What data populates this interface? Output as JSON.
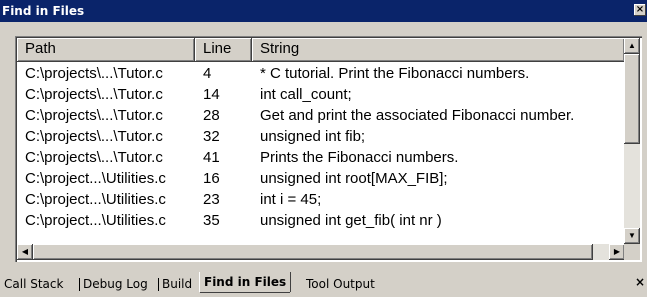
{
  "window": {
    "title": "Find in Files",
    "close_glyph": "×",
    "close_icon": "close-icon"
  },
  "columns": [
    "Path",
    "Line",
    "String"
  ],
  "results": [
    {
      "path": "C:\\projects\\...\\Tutor.c",
      "line": "4",
      "string": "* C tutorial. Print the Fibonacci numbers."
    },
    {
      "path": "C:\\projects\\...\\Tutor.c",
      "line": "14",
      "string": "int call_count;"
    },
    {
      "path": "C:\\projects\\...\\Tutor.c",
      "line": "28",
      "string": "Get and print the associated Fibonacci number."
    },
    {
      "path": "C:\\projects\\...\\Tutor.c",
      "line": "32",
      "string": "unsigned int fib;"
    },
    {
      "path": "C:\\projects\\...\\Tutor.c",
      "line": "41",
      "string": "Prints the Fibonacci numbers."
    },
    {
      "path": "C:\\project...\\Utilities.c",
      "line": "16",
      "string": "unsigned int root[MAX_FIB];"
    },
    {
      "path": "C:\\project...\\Utilities.c",
      "line": "23",
      "string": "int i = 45;"
    },
    {
      "path": "C:\\project...\\Utilities.c",
      "line": "35",
      "string": "unsigned int get_fib( int nr )"
    }
  ],
  "scrollbar": {
    "up": "▲",
    "down": "▼",
    "left": "◀",
    "right": "▶"
  },
  "tabs": [
    {
      "label": "Call Stack",
      "active": false
    },
    {
      "label": "Debug Log",
      "active": false
    },
    {
      "label": "Build",
      "active": false
    },
    {
      "label": "Find in Files",
      "active": true
    },
    {
      "label": "Tool Output",
      "active": false
    }
  ],
  "tabbar_close_glyph": "×",
  "colors": {
    "titlebar": "#0a246a",
    "face": "#d4d0c8",
    "list_bg": "#ffffff"
  }
}
